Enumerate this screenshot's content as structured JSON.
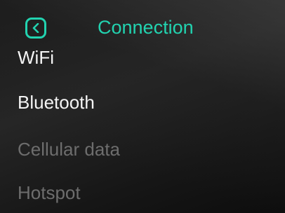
{
  "header": {
    "title": "Connection",
    "back_icon": "chevron-left-icon",
    "accent_color": "#22d3b0"
  },
  "menu": {
    "items": [
      {
        "label": "WiFi",
        "enabled": true
      },
      {
        "label": "Bluetooth",
        "enabled": true
      },
      {
        "label": "Cellular data",
        "enabled": false
      },
      {
        "label": "Hotspot",
        "enabled": false
      }
    ]
  },
  "colors": {
    "enabled_text": "#f4f4f4",
    "disabled_text": "#6d6d6d",
    "background": "#1c1c1c"
  }
}
